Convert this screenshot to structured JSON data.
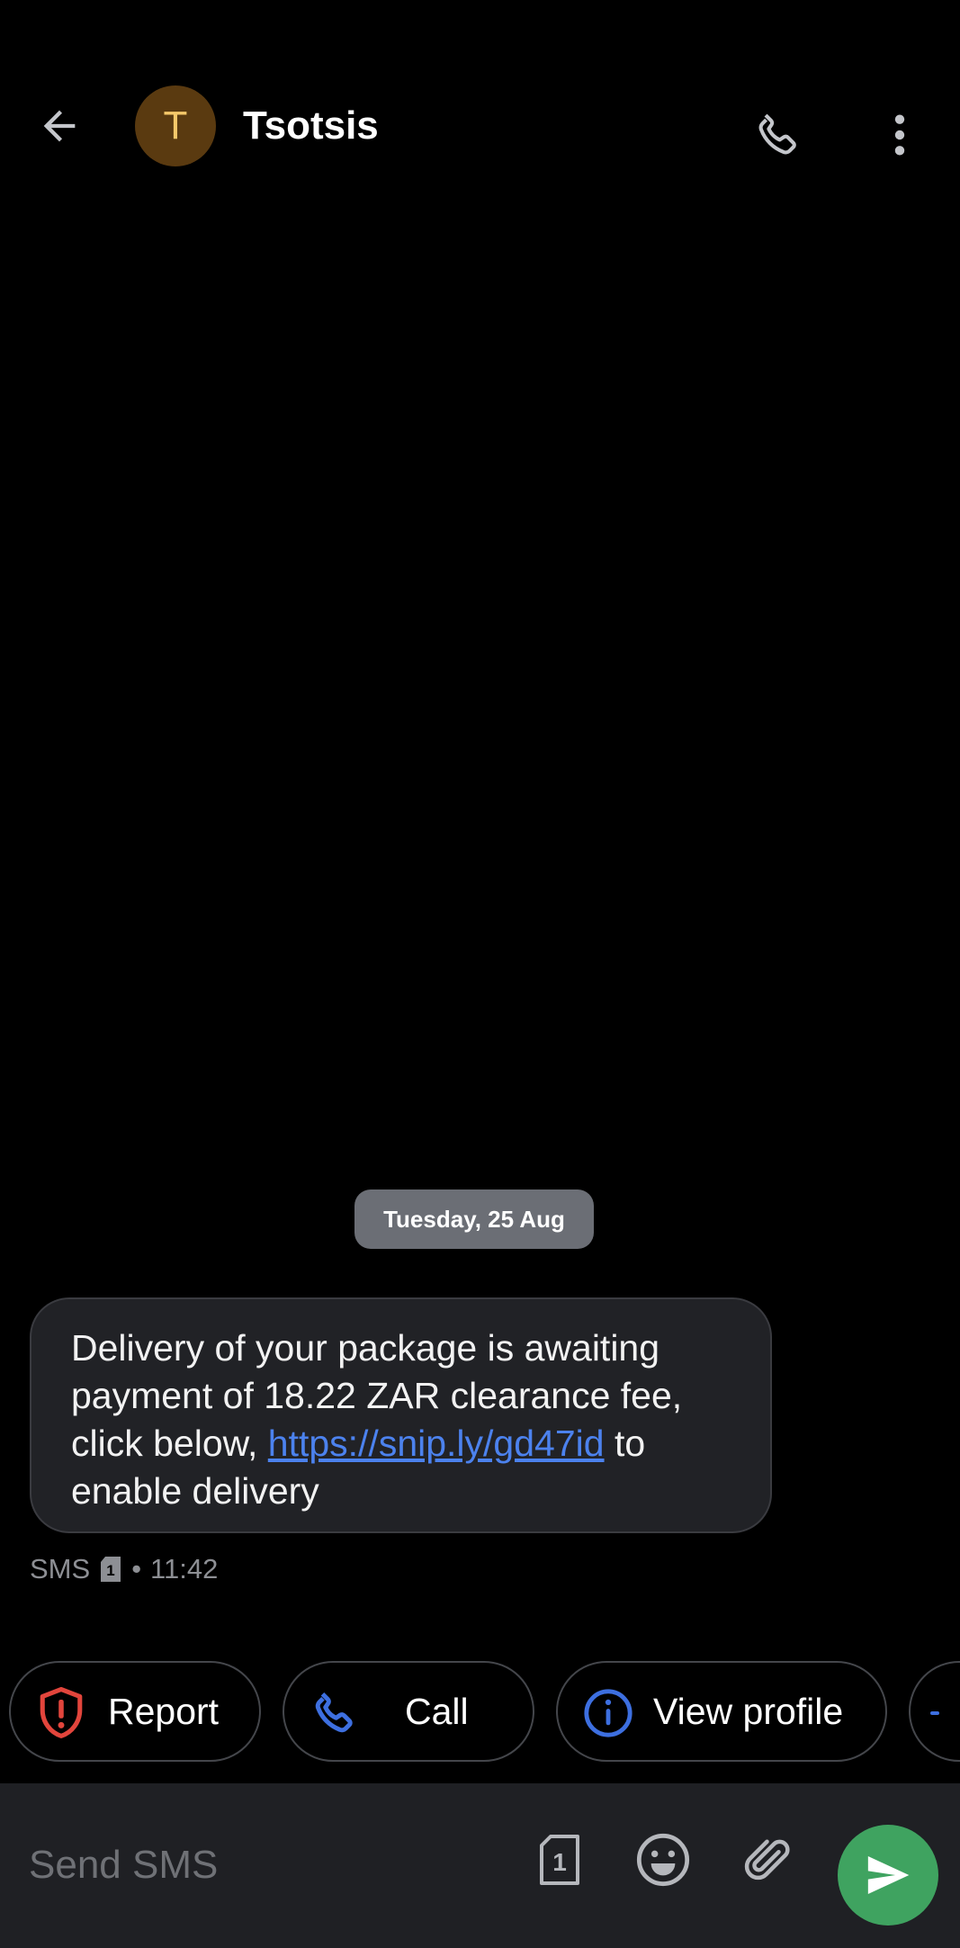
{
  "header": {
    "avatar_letter": "T",
    "contact_name": "Tsotsis"
  },
  "conversation": {
    "date_label": "Tuesday, 25 Aug",
    "message": {
      "text_before_link": "Delivery of your package is awaiting payment of 18.22 ZAR clearance fee, click below, ",
      "link": "https://snip.ly/gd47id",
      "text_after_link": " to enable delivery",
      "channel": "SMS",
      "sim_number": "1",
      "separator": "•",
      "time": "11:42"
    }
  },
  "actions": [
    {
      "label": "Report",
      "icon": "shield-alert-icon"
    },
    {
      "label": "Call",
      "icon": "phone-icon"
    },
    {
      "label": "View profile",
      "icon": "info-icon"
    }
  ],
  "composer": {
    "placeholder": "Send SMS",
    "sim_number": "1"
  },
  "colors": {
    "accent_blue": "#3d6fe0",
    "report_red": "#e2453c",
    "send_green": "#3fa360",
    "avatar_bg": "#5a3a10"
  }
}
